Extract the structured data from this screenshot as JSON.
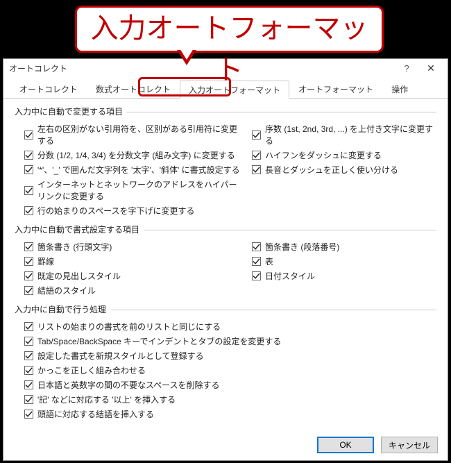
{
  "callout_text": "入力オートフォーマット",
  "dialog": {
    "title": "オートコレクト",
    "help": "?",
    "close": "✕"
  },
  "tabs": [
    {
      "label": "オートコレクト",
      "active": false
    },
    {
      "label": "数式オートコレクト",
      "active": false
    },
    {
      "label": "入力オートフォーマット",
      "active": true
    },
    {
      "label": "オートフォーマット",
      "active": false
    },
    {
      "label": "操作",
      "active": false
    }
  ],
  "groups": {
    "g1": {
      "title": "入力中に自動で変更する項目",
      "left": [
        {
          "label": "左右の区別がない引用符を、区別がある引用符に変更する",
          "checked": true
        },
        {
          "label": "分数 (1/2, 1/4, 3/4) を分数文字 (組み文字) に変更する",
          "checked": true
        },
        {
          "label": "'*'、'_' で囲んだ文字列を '太字'、'斜体' に書式設定する",
          "checked": true
        },
        {
          "label": "インターネットとネットワークのアドレスをハイパーリンクに変更する",
          "checked": true
        },
        {
          "label": "行の始まりのスペースを字下げに変更する",
          "checked": true
        }
      ],
      "right": [
        {
          "label": "序数 (1st, 2nd, 3rd, ...) を上付き文字に変更する",
          "checked": true
        },
        {
          "label": "ハイフンをダッシュに変更する",
          "checked": true
        },
        {
          "label": "長音とダッシュを正しく使い分ける",
          "checked": true
        }
      ]
    },
    "g2": {
      "title": "入力中に自動で書式設定する項目",
      "left": [
        {
          "label": "箇条書き (行頭文字)",
          "checked": true
        },
        {
          "label": "罫線",
          "checked": true
        },
        {
          "label": "既定の見出しスタイル",
          "checked": true
        },
        {
          "label": "結語のスタイル",
          "checked": true
        }
      ],
      "right": [
        {
          "label": "箇条書き (段落番号)",
          "checked": true
        },
        {
          "label": "表",
          "checked": true
        },
        {
          "label": "日付スタイル",
          "checked": true
        }
      ]
    },
    "g3": {
      "title": "入力中に自動で行う処理",
      "items": [
        {
          "label": "リストの始まりの書式を前のリストと同じにする",
          "checked": true
        },
        {
          "label": "Tab/Space/BackSpace キーでインデントとタブの設定を変更する",
          "checked": true
        },
        {
          "label": "設定した書式を新規スタイルとして登録する",
          "checked": true
        },
        {
          "label": "かっこを正しく組み合わせる",
          "checked": true
        },
        {
          "label": "日本語と英数字の間の不要なスペースを削除する",
          "checked": true
        },
        {
          "label": "'記' などに対応する '以上' を挿入する",
          "checked": true
        },
        {
          "label": "頭語に対応する結語を挿入する",
          "checked": true
        }
      ]
    }
  },
  "buttons": {
    "ok": "OK",
    "cancel": "キャンセル"
  }
}
